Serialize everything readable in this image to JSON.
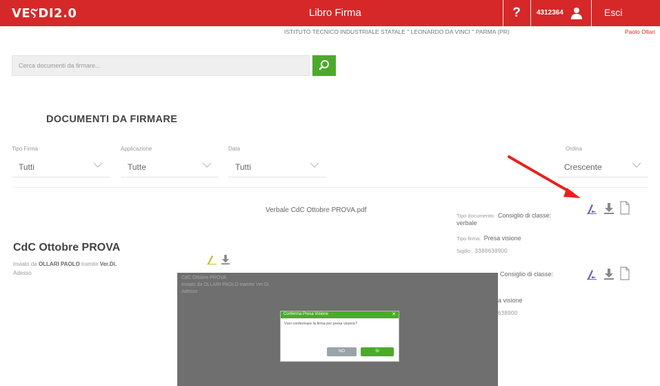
{
  "topbar": {
    "logo": "VEⲊDI2.0",
    "title": "Libro Firma",
    "help_label": "?",
    "user_code": "4312364",
    "logout_label": "Esci",
    "background": "#d62828"
  },
  "subheader": {
    "institute": "ISTITUTO TECNICO INDUSTRIALE STATALE \" LEONARDO DA VINCI \" PARMA (PR)",
    "user_name": "Paolo Ollari"
  },
  "search": {
    "placeholder": "Cerca documenti da firmare..."
  },
  "section_title": "DOCUMENTI DA FIRMARE",
  "filters": {
    "tipo_firma": {
      "label": "Tipo Firma",
      "value": "Tutti"
    },
    "applicazione": {
      "label": "Applicazione",
      "value": "Tutte"
    },
    "data": {
      "label": "Data",
      "value": "Tutti"
    },
    "ordina": {
      "label": "Ordina",
      "value": "Crescente"
    }
  },
  "documents": [
    {
      "file_name": "Verbale CdC Ottobre PROVA.pdf",
      "tipo_documento_label": "Tipo documento:",
      "tipo_documento_value": "Consiglio di classe:",
      "tipo_documento_value2": "verbale",
      "tipo_firma_label": "Tipo firma:",
      "tipo_firma_value": "Presa visione",
      "code_label": "Sigillo:",
      "code_value": "3388638900"
    },
    {
      "tipo_documento_value": "Consiglio di classe:",
      "tipo_firma_value": "a visione",
      "code_value": "638900"
    }
  ],
  "group": {
    "title": "CdC Ottobre PROVA",
    "inviato_da_label": "Inviato da",
    "sender": "OLLARI PAOLO",
    "app_label": "tramite",
    "app": "Ver.Di.",
    "date": "Adesso"
  },
  "overlay": {
    "bg_text_1": "CdC Ottobre PROVA",
    "bg_text_2": "Inviato da OLLARI PAOLO tramite Ver.Di.",
    "bg_text_3": "Adesso"
  },
  "modal": {
    "title": "Conferma Presa Visione",
    "body": "Vuoi confermare la firma per presa visione?",
    "no_label": "NO",
    "si_label": "SI",
    "accent": "#4caa2a"
  },
  "colors": {
    "brand_red": "#d62828",
    "accent_green": "#4caa2a",
    "sign_icon": "#6b5fb5"
  }
}
